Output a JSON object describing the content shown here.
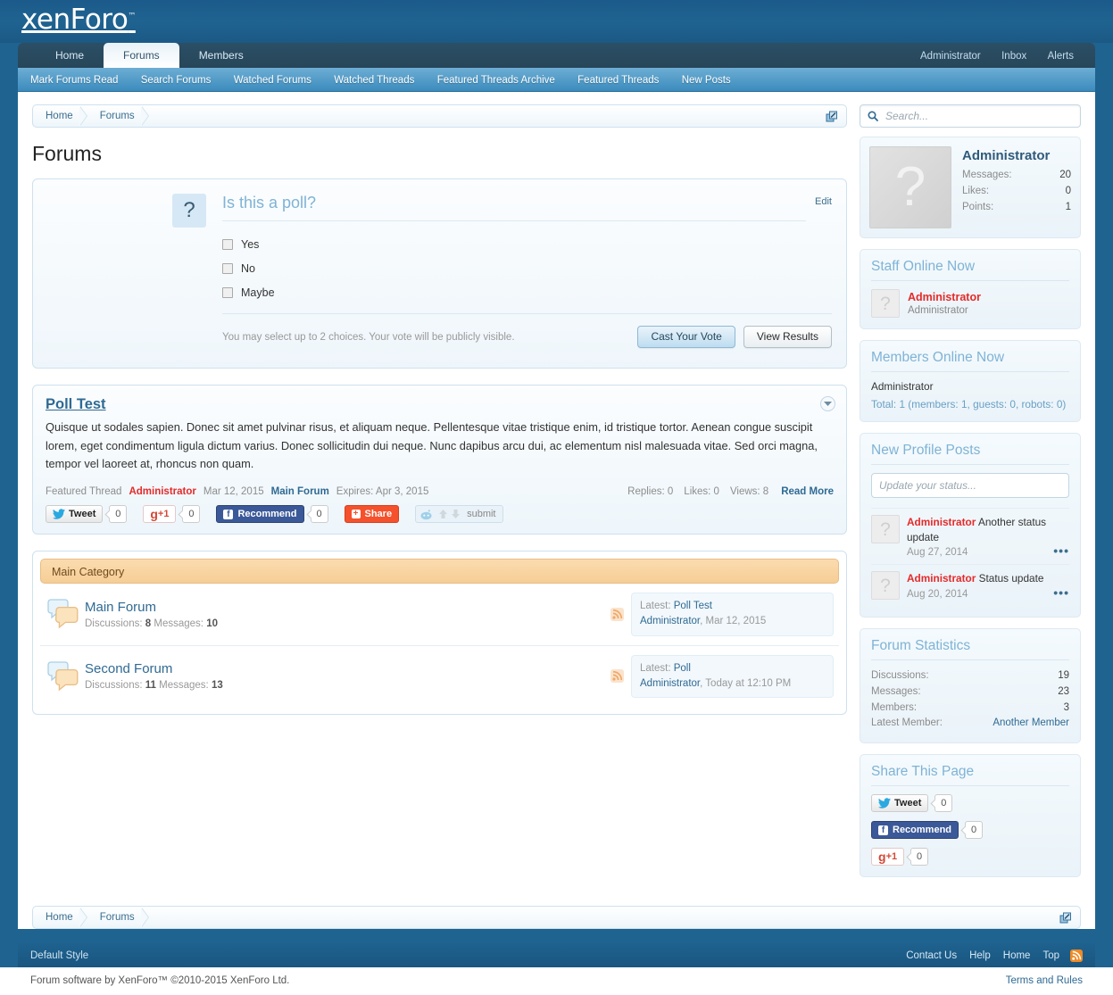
{
  "header": {
    "logo": "xenForo",
    "logo_tm": "™"
  },
  "nav": {
    "tabs": [
      {
        "label": "Home",
        "active": false
      },
      {
        "label": "Forums",
        "active": true
      },
      {
        "label": "Members",
        "active": false
      }
    ],
    "user_links": [
      {
        "label": "Administrator"
      },
      {
        "label": "Inbox"
      },
      {
        "label": "Alerts"
      }
    ],
    "subnav": [
      {
        "label": "Mark Forums Read"
      },
      {
        "label": "Search Forums"
      },
      {
        "label": "Watched Forums"
      },
      {
        "label": "Watched Threads"
      },
      {
        "label": "Featured Threads Archive"
      },
      {
        "label": "Featured Threads"
      },
      {
        "label": "New Posts"
      }
    ]
  },
  "search": {
    "placeholder": "Search...",
    "value": "",
    "icon": "search-icon"
  },
  "breadcrumb": {
    "items": [
      {
        "label": "Home"
      },
      {
        "label": "Forums"
      }
    ],
    "jump_icon": "open-in-new-icon"
  },
  "page_title": "Forums",
  "poll": {
    "icon": "question-mark-icon",
    "question": "Is this a poll?",
    "edit_label": "Edit",
    "options": [
      {
        "label": "Yes",
        "checked": false
      },
      {
        "label": "No",
        "checked": false
      },
      {
        "label": "Maybe",
        "checked": false
      }
    ],
    "note": "You may select up to 2 choices. Your vote will be publicly visible.",
    "vote_button": "Cast Your Vote",
    "results_button": "View Results"
  },
  "featured_thread": {
    "title": "Poll Test",
    "snippet": "Quisque ut sodales sapien. Donec sit amet pulvinar risus, et aliquam neque. Pellentesque vitae tristique enim, id tristique tortor. Aenean congue suscipit lorem, eget condimentum ligula dictum varius. Donec sollicitudin dui neque. Nunc dapibus arcu dui, ac elementum nisl malesuada vitae. Sed orci magna, tempor vel laoreet at, rhoncus non quam.",
    "badge": "Featured Thread",
    "author": "Administrator",
    "date": "Mar 12, 2015",
    "forum": "Main Forum",
    "expires": "Expires: Apr 3, 2015",
    "replies": "Replies: 0",
    "likes": "Likes: 0",
    "views": "Views: 8",
    "read_more": "Read More",
    "collapse_icon": "chevron-down-circle-icon",
    "share": {
      "tweet_label": "Tweet",
      "tweet_count": "0",
      "gplus_label": "+1",
      "gplus_mark": "g",
      "gplus_count": "0",
      "facebook_label": "Recommend",
      "facebook_count": "0",
      "share_label": "Share",
      "reddit_label": "submit"
    }
  },
  "nodes": {
    "category": "Main Category",
    "forums": [
      {
        "title": "Main Forum",
        "stats_discussions_label": "Discussions:",
        "stats_discussions": "8",
        "stats_messages_label": "Messages:",
        "stats_messages": "10",
        "latest_label": "Latest:",
        "latest_thread": "Poll Test",
        "latest_author": "Administrator",
        "latest_date": "Mar 12, 2015",
        "icon": "forum-bubbles-icon",
        "rss_icon": "rss-icon"
      },
      {
        "title": "Second Forum",
        "stats_discussions_label": "Discussions:",
        "stats_discussions": "11",
        "stats_messages_label": "Messages:",
        "stats_messages": "13",
        "latest_label": "Latest:",
        "latest_thread": "Poll",
        "latest_author": "Administrator",
        "latest_date": "Today at 12:10 PM",
        "icon": "forum-bubbles-icon",
        "rss_icon": "rss-icon"
      }
    ]
  },
  "sidebar": {
    "visitor": {
      "name": "Administrator",
      "avatar_glyph": "?",
      "stats": [
        {
          "label": "Messages:",
          "value": "20"
        },
        {
          "label": "Likes:",
          "value": "0"
        },
        {
          "label": "Points:",
          "value": "1"
        }
      ]
    },
    "staff_online": {
      "title": "Staff Online Now",
      "members": [
        {
          "name": "Administrator",
          "title": "Administrator",
          "avatar_glyph": "?"
        }
      ]
    },
    "members_online": {
      "title": "Members Online Now",
      "names": "Administrator",
      "total": "Total: 1 (members: 1, guests: 0, robots: 0)"
    },
    "profile_posts": {
      "title": "New Profile Posts",
      "status_placeholder": "Update your status...",
      "status_value": "",
      "posts": [
        {
          "author": "Administrator",
          "message": "Another status update",
          "date": "Aug 27, 2014",
          "more": "•••",
          "avatar_glyph": "?"
        },
        {
          "author": "Administrator",
          "message": "Status update",
          "date": "Aug 20, 2014",
          "more": "•••",
          "avatar_glyph": "?"
        }
      ]
    },
    "forum_statistics": {
      "title": "Forum Statistics",
      "rows": [
        {
          "label": "Discussions:",
          "value": "19"
        },
        {
          "label": "Messages:",
          "value": "23"
        },
        {
          "label": "Members:",
          "value": "3"
        },
        {
          "label": "Latest Member:",
          "value": "Another Member"
        }
      ]
    },
    "share_page": {
      "title": "Share This Page",
      "tweet_label": "Tweet",
      "tweet_count": "0",
      "facebook_label": "Recommend",
      "facebook_count": "0",
      "gplus_mark": "g",
      "gplus_label": "+1",
      "gplus_count": "0"
    }
  },
  "footer": {
    "style_label": "Default Style",
    "links": [
      {
        "label": "Contact Us"
      },
      {
        "label": "Help"
      },
      {
        "label": "Home"
      },
      {
        "label": "Top"
      }
    ],
    "rss_icon": "rss-icon",
    "copyright": "Forum software by XenForo™ ©2010-2015 XenForo Ltd.",
    "terms": "Terms and Rules"
  },
  "colors": {
    "brand_blue": "#1f6391",
    "accent_link": "#2f6a93",
    "user_red": "#e52a2a",
    "category_orange": "#f6cd96",
    "poll_title": "#7fb3d5"
  }
}
